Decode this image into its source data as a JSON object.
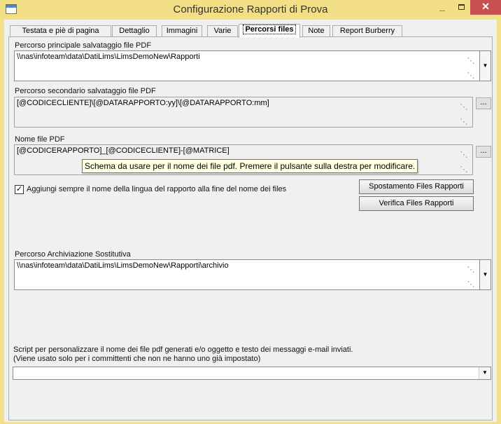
{
  "window": {
    "title": "Configurazione Rapporti di Prova",
    "minimize_glyph": "_",
    "close_glyph": "✕"
  },
  "tabs": [
    {
      "label": "Testata e piè di pagina"
    },
    {
      "label": "Dettaglio"
    },
    {
      "label": "Immagini"
    },
    {
      "label": "Varie"
    },
    {
      "label": "Percorsi files"
    },
    {
      "label": "Note"
    },
    {
      "label": "Report Burberry"
    }
  ],
  "active_tab": "Percorsi files",
  "fields": {
    "main_path": {
      "label": "Percorso principale salvataggio file PDF",
      "value": "\\\\nas\\infoteam\\data\\DatiLims\\LimsDemoNew\\Rapporti"
    },
    "secondary_path": {
      "label": "Percorso secondario salvataggio file PDF",
      "value": "[@CODICECLIENTE]\\[@DATARAPPORTO:yy]\\[@DATARAPPORTO:mm]"
    },
    "pdf_name": {
      "label": "Nome file PDF",
      "value": "[@CODICERAPPORTO]_[@CODICECLIENTE]-[@MATRICE]"
    },
    "archive_path": {
      "label": "Percorso Archiviazione Sostitutiva",
      "value": "\\\\nas\\infoteam\\data\\DatiLims\\LimsDemoNew\\Rapporti\\archivio"
    },
    "script": {
      "label_line1": "Script per personalizzare il nome dei file pdf generati e/o oggetto e testo dei messaggi e-mail inviati.",
      "label_line2": "(Viene usato solo per i committenti che non ne hanno uno già impostato)",
      "value": ""
    }
  },
  "tooltip": "Schema da usare per il nome dei file pdf. Premere il pulsante sulla destra per modificare.",
  "checkbox": {
    "label": "Aggiungi sempre il nome della lingua del rapporto alla fine del nome dei files",
    "checked": true,
    "mark": "✓"
  },
  "buttons": {
    "move_files": "Spostamento Files Rapporti",
    "check_files": "Verifica Files Rapporti",
    "ellipsis": "...",
    "dropdown": "▼"
  },
  "colors": {
    "titlebar": "#f2df86",
    "close": "#c75050",
    "tooltip_bg": "#ffffe1"
  }
}
